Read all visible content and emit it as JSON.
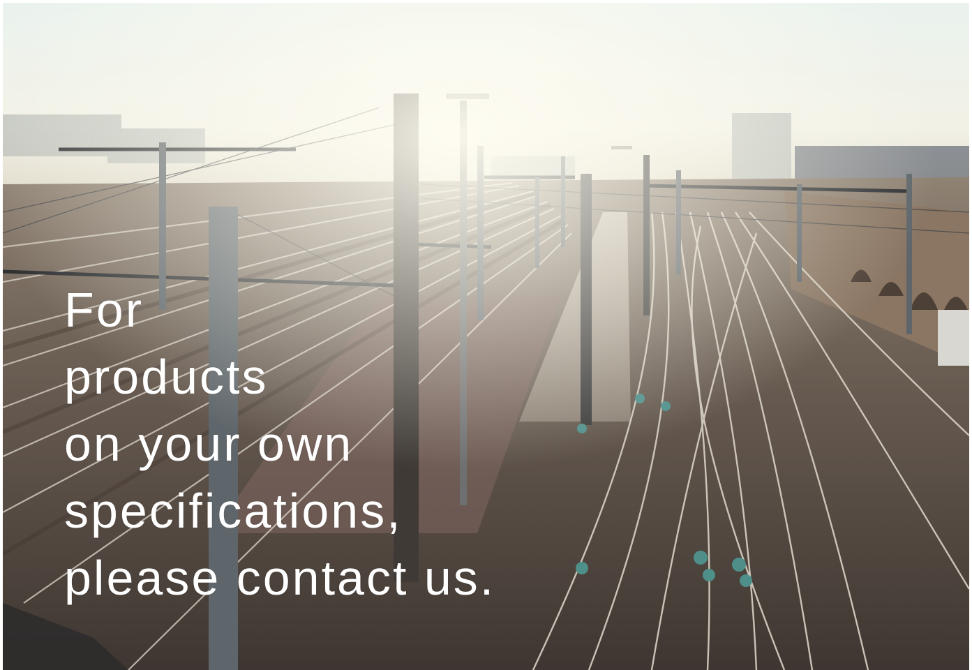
{
  "headline": {
    "lines": [
      "For",
      "products",
      "on your own",
      "specifications,",
      "please contact us."
    ]
  },
  "colors": {
    "text": "#ffffff",
    "sky": "#e9eee7",
    "ground": "#5b4f45",
    "ballast": "#7a6d63"
  }
}
